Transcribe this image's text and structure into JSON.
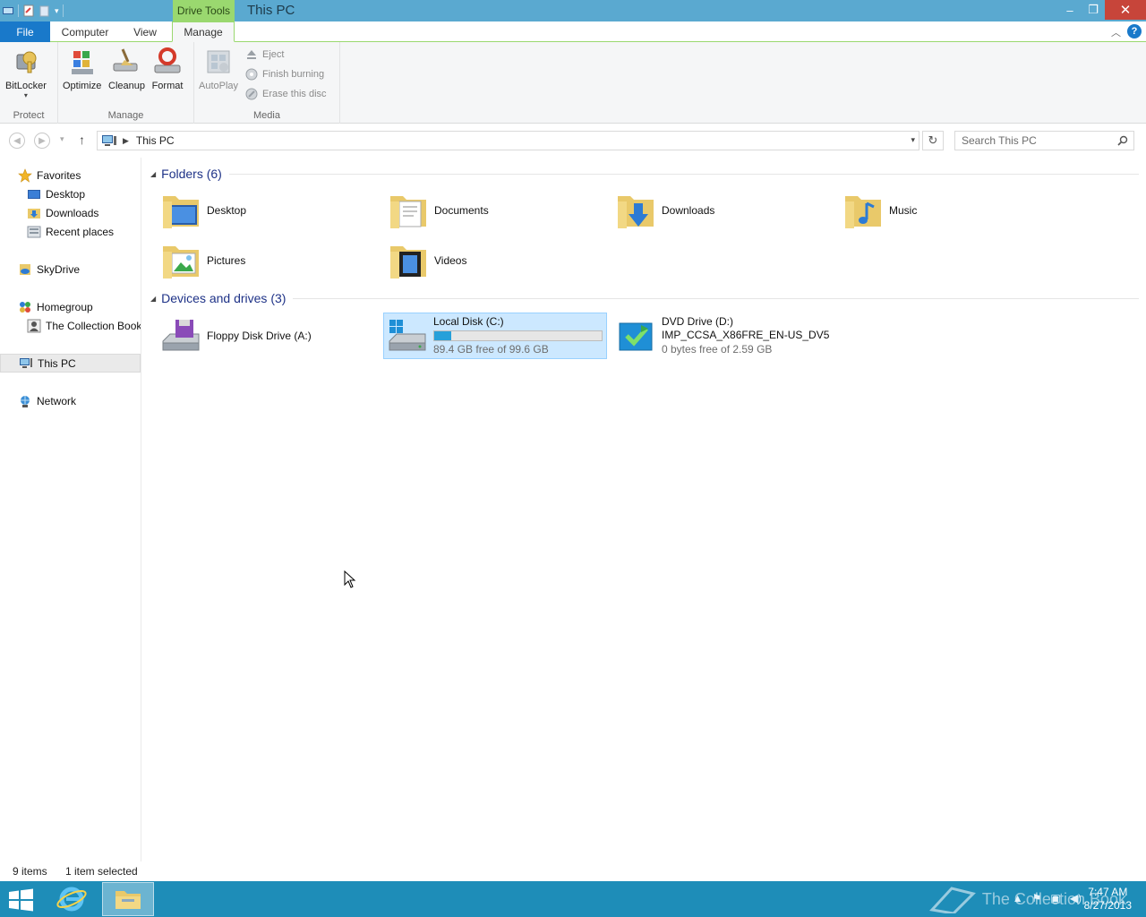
{
  "window": {
    "title": "This PC",
    "contextual_tab": "Drive Tools",
    "controls": {
      "minimize": "–",
      "restore": "❐",
      "close": "✕"
    }
  },
  "ribbon": {
    "tabs": [
      "File",
      "Computer",
      "View",
      "Manage"
    ],
    "active_tab": "Manage",
    "help": "?",
    "groups": {
      "protect": {
        "label": "Protect",
        "buttons": [
          "BitLocker"
        ]
      },
      "manage": {
        "label": "Manage",
        "buttons": [
          "Optimize",
          "Cleanup",
          "Format"
        ]
      },
      "media": {
        "label": "Media",
        "autoplay": "AutoPlay",
        "small_buttons": [
          "Eject",
          "Finish burning",
          "Erase this disc"
        ]
      }
    }
  },
  "addressbar": {
    "path": "This PC",
    "search_placeholder": "Search This PC"
  },
  "navpane": {
    "items": [
      {
        "label": "Favorites",
        "icon": "star-icon",
        "level": 0
      },
      {
        "label": "Desktop",
        "icon": "desktop-icon",
        "level": 1
      },
      {
        "label": "Downloads",
        "icon": "downloads-folder-icon",
        "level": 1
      },
      {
        "label": "Recent places",
        "icon": "recent-places-icon",
        "level": 1
      },
      {
        "label": "SkyDrive",
        "icon": "skydrive-icon",
        "level": 0
      },
      {
        "label": "Homegroup",
        "icon": "homegroup-icon",
        "level": 0
      },
      {
        "label": "The Collection Book",
        "icon": "user-icon",
        "level": 1
      },
      {
        "label": "This PC",
        "icon": "computer-icon",
        "level": 0,
        "selected": true
      },
      {
        "label": "Network",
        "icon": "network-icon",
        "level": 0
      }
    ]
  },
  "content": {
    "folders_header": "Folders (6)",
    "folders": [
      {
        "name": "Desktop",
        "icon": "desktop-folder-icon"
      },
      {
        "name": "Documents",
        "icon": "documents-folder-icon"
      },
      {
        "name": "Downloads",
        "icon": "downloads-folder-icon"
      },
      {
        "name": "Music",
        "icon": "music-folder-icon"
      },
      {
        "name": "Pictures",
        "icon": "pictures-folder-icon"
      },
      {
        "name": "Videos",
        "icon": "videos-folder-icon"
      }
    ],
    "drives_header": "Devices and drives (3)",
    "drives": [
      {
        "name": "Floppy Disk Drive (A:)",
        "icon": "floppy-drive-icon"
      },
      {
        "name": "Local Disk (C:)",
        "free": "89.4 GB free of 99.6 GB",
        "used_fraction": 0.1,
        "selected": true,
        "icon": "hard-drive-icon"
      },
      {
        "name": "DVD Drive (D:)",
        "label": "IMP_CCSA_X86FRE_EN-US_DV5",
        "free": "0 bytes free of 2.59 GB",
        "icon": "dvd-drive-icon"
      }
    ]
  },
  "statusbar": {
    "items_count": "9 items",
    "selection": "1 item selected"
  },
  "taskbar": {
    "time": "7:47 AM",
    "date": "8/27/2013",
    "watermark": "The Collection Book"
  },
  "colors": {
    "titlebar": "#5aa9d0",
    "drive_tools": "#9ad86f",
    "file_tab": "#1979ca",
    "taskbar": "#1e8db8",
    "selection": "#cce8ff",
    "bar_fill": "#26a0da",
    "group_header": "#1e3287"
  }
}
